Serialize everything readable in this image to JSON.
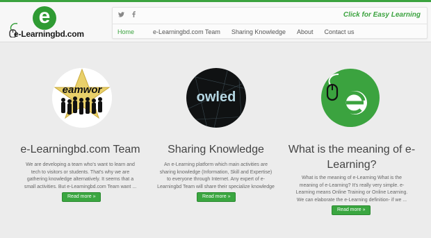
{
  "brand": {
    "logo_letter": "e",
    "logo_text": "e-Learningbd.com"
  },
  "social": {
    "twitter_glyph": "𝕥",
    "facebook_glyph": "f"
  },
  "cta": "Click for Easy Learning",
  "menu": [
    "Home",
    "e-Learningbd.com Team",
    "Sharing Knowledge",
    "About",
    "Contact us"
  ],
  "colors": {
    "accent": "#3ba33f",
    "button": "#3aa640"
  },
  "features": [
    {
      "title": "e-Learningbd.com Team",
      "text": "We are developing a team who's want to learn and tech to visitors or students. That's why we are gathering knowledge alternatively. It seems that a small activities. But e-Learningbd.com Team want ...",
      "button": "Read more »"
    },
    {
      "title": "Sharing Knowledge",
      "text": "An e-Learning platform which main activities are sharing knowledge (Information, Skill and Expertise) to everyone through Internet. Any expert of e-Learningbd Team will share their specialize knowledge ...",
      "button": "Read more »"
    },
    {
      "title": "What is the meaning of e-Learning?",
      "text": "What is the meaning of e-Learning What is the meaning of e-Learning? It's really very simple. e-Learning means Online Training or Online Learning. We can elaborate the e-Learning definition- if we ...",
      "button": "Read more »"
    }
  ],
  "thumbs": {
    "team_word": "eamwor",
    "knowledge_word": "owled"
  }
}
